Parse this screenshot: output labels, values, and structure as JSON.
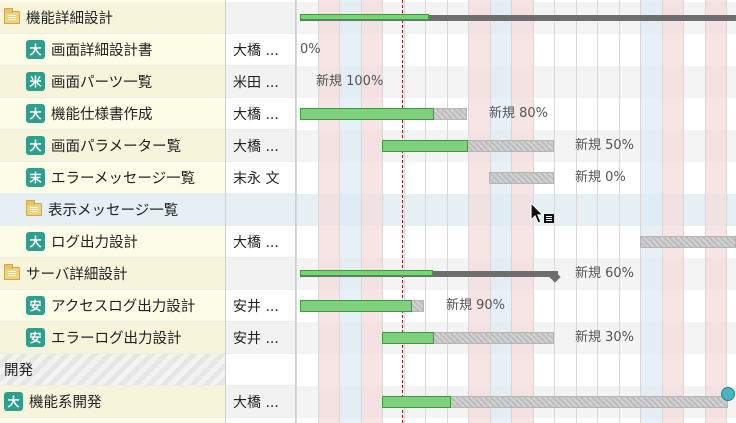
{
  "rows": [
    {
      "kind": "folder",
      "indent": 0,
      "name": "機能詳細設計",
      "assignee": "",
      "summary": true,
      "progress": 0.43,
      "bar_label": ""
    },
    {
      "kind": "task",
      "indent": 1,
      "badge": "大",
      "name": "画面詳細設計書",
      "assignee": "大橋 ...",
      "bar_label": "0%"
    },
    {
      "kind": "task",
      "indent": 1,
      "badge": "米",
      "name": "画面パーツ一覧",
      "assignee": "米田 ...",
      "bar_label": "新規 100%"
    },
    {
      "kind": "task",
      "indent": 1,
      "badge": "大",
      "name": "機能仕様書作成",
      "assignee": "大橋 ...",
      "progress": 0.8,
      "bar_label": "新規 80%"
    },
    {
      "kind": "task",
      "indent": 1,
      "badge": "大",
      "name": "画面パラメーター覧",
      "assignee": "大橋 ...",
      "progress": 0.5,
      "bar_label": "新規 50%"
    },
    {
      "kind": "task",
      "indent": 1,
      "badge": "末",
      "name": "エラーメッセージ一覧",
      "assignee": "末永 文",
      "progress": 0.0,
      "bar_label": "新規 0%"
    },
    {
      "kind": "folder",
      "indent": 1,
      "name": "表示メッセージ一覧",
      "assignee": "",
      "bar_label": ""
    },
    {
      "kind": "task",
      "indent": 1,
      "badge": "大",
      "name": "ログ出力設計",
      "assignee": "大橋 ...",
      "bar_label": ""
    },
    {
      "kind": "folder",
      "indent": 0,
      "name": "サーバ詳細設計",
      "assignee": "",
      "summary": true,
      "progress": 0.6,
      "bar_label": "新規 60%"
    },
    {
      "kind": "task",
      "indent": 1,
      "badge": "安",
      "name": "アクセスログ出力設計",
      "assignee": "安井 ...",
      "progress": 0.9,
      "bar_label": "新規 90%"
    },
    {
      "kind": "task",
      "indent": 1,
      "badge": "安",
      "name": "エラーログ出力設計",
      "assignee": "安井 ...",
      "progress": 0.3,
      "bar_label": "新規 30%"
    },
    {
      "kind": "section",
      "indent": 0,
      "name": "開発",
      "assignee": "",
      "bar_label": ""
    },
    {
      "kind": "task",
      "indent": 0,
      "badge": "大",
      "name": "機能系開発",
      "assignee": "大橋 ...",
      "progress": 0.2,
      "bar_label": ""
    }
  ],
  "colors": {
    "progress_fill": "#7ed07e",
    "progress_border": "#35a035",
    "today_line": "#a11e1e",
    "badge": "#2e9e8f",
    "tree_bg": "#fdfce6",
    "weekend_column": "#f3dada",
    "holiday_column": "#dde9f3"
  },
  "icons": {
    "folder": "folder-icon",
    "cursor": "pointer-cursor-icon",
    "handle": "drag-handle-icon"
  }
}
